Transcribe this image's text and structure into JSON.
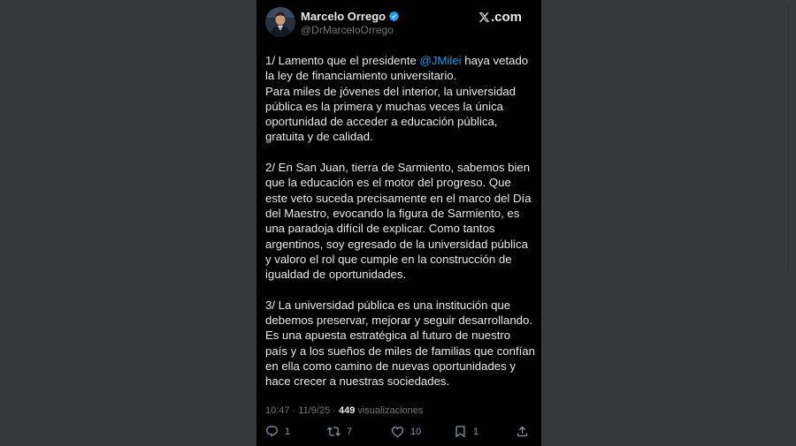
{
  "author": {
    "name": "Marcelo Orrego",
    "handle": "@DrMarceloOrrego"
  },
  "brand": {
    "label": ".com",
    "icon": "x-logo-icon"
  },
  "tweet": {
    "p1_before": "1/ Lamento que el presidente ",
    "mention": "@JMilei",
    "p1_after": " haya vetado la ley de financiamiento universitario.",
    "p1_line2": "Para miles de jóvenes del interior, la universidad pública es la primera y muchas veces la única oportunidad de acceder a educación pública, gratuita y de calidad.",
    "p2": "2/ En San Juan, tierra de Sarmiento, sabemos bien que la educación es el motor del progreso. Que este veto suceda precisamente en el marco del Día del Maestro, evocando la figura de Sarmiento, es una paradoja difícil de explicar. Como tantos argentinos, soy egresado de la universidad pública y valoro el rol que cumple en la construcción de igualdad de oportunidades.",
    "p3": "3/ La universidad pública es una institución que debemos preservar, mejorar y seguir desarrollando. Es una apuesta estratégica al futuro de nuestro país y a los sueños de miles de familias que confían en ella como camino de nuevas oportunidades y hace crecer a nuestras sociedades."
  },
  "meta": {
    "timestamp": "10:47 · 11/9/25 · ",
    "views_count": "449",
    "views_label": " visualizaciones"
  },
  "actions": {
    "replies": "1",
    "reposts": "7",
    "likes": "10",
    "bookmarks": "1"
  },
  "colors": {
    "background": "#37383b",
    "card": "#000000",
    "text": "#e7e9ea",
    "muted": "#71767b",
    "link": "#1d9bf0",
    "verified": "#1d9bf0"
  }
}
